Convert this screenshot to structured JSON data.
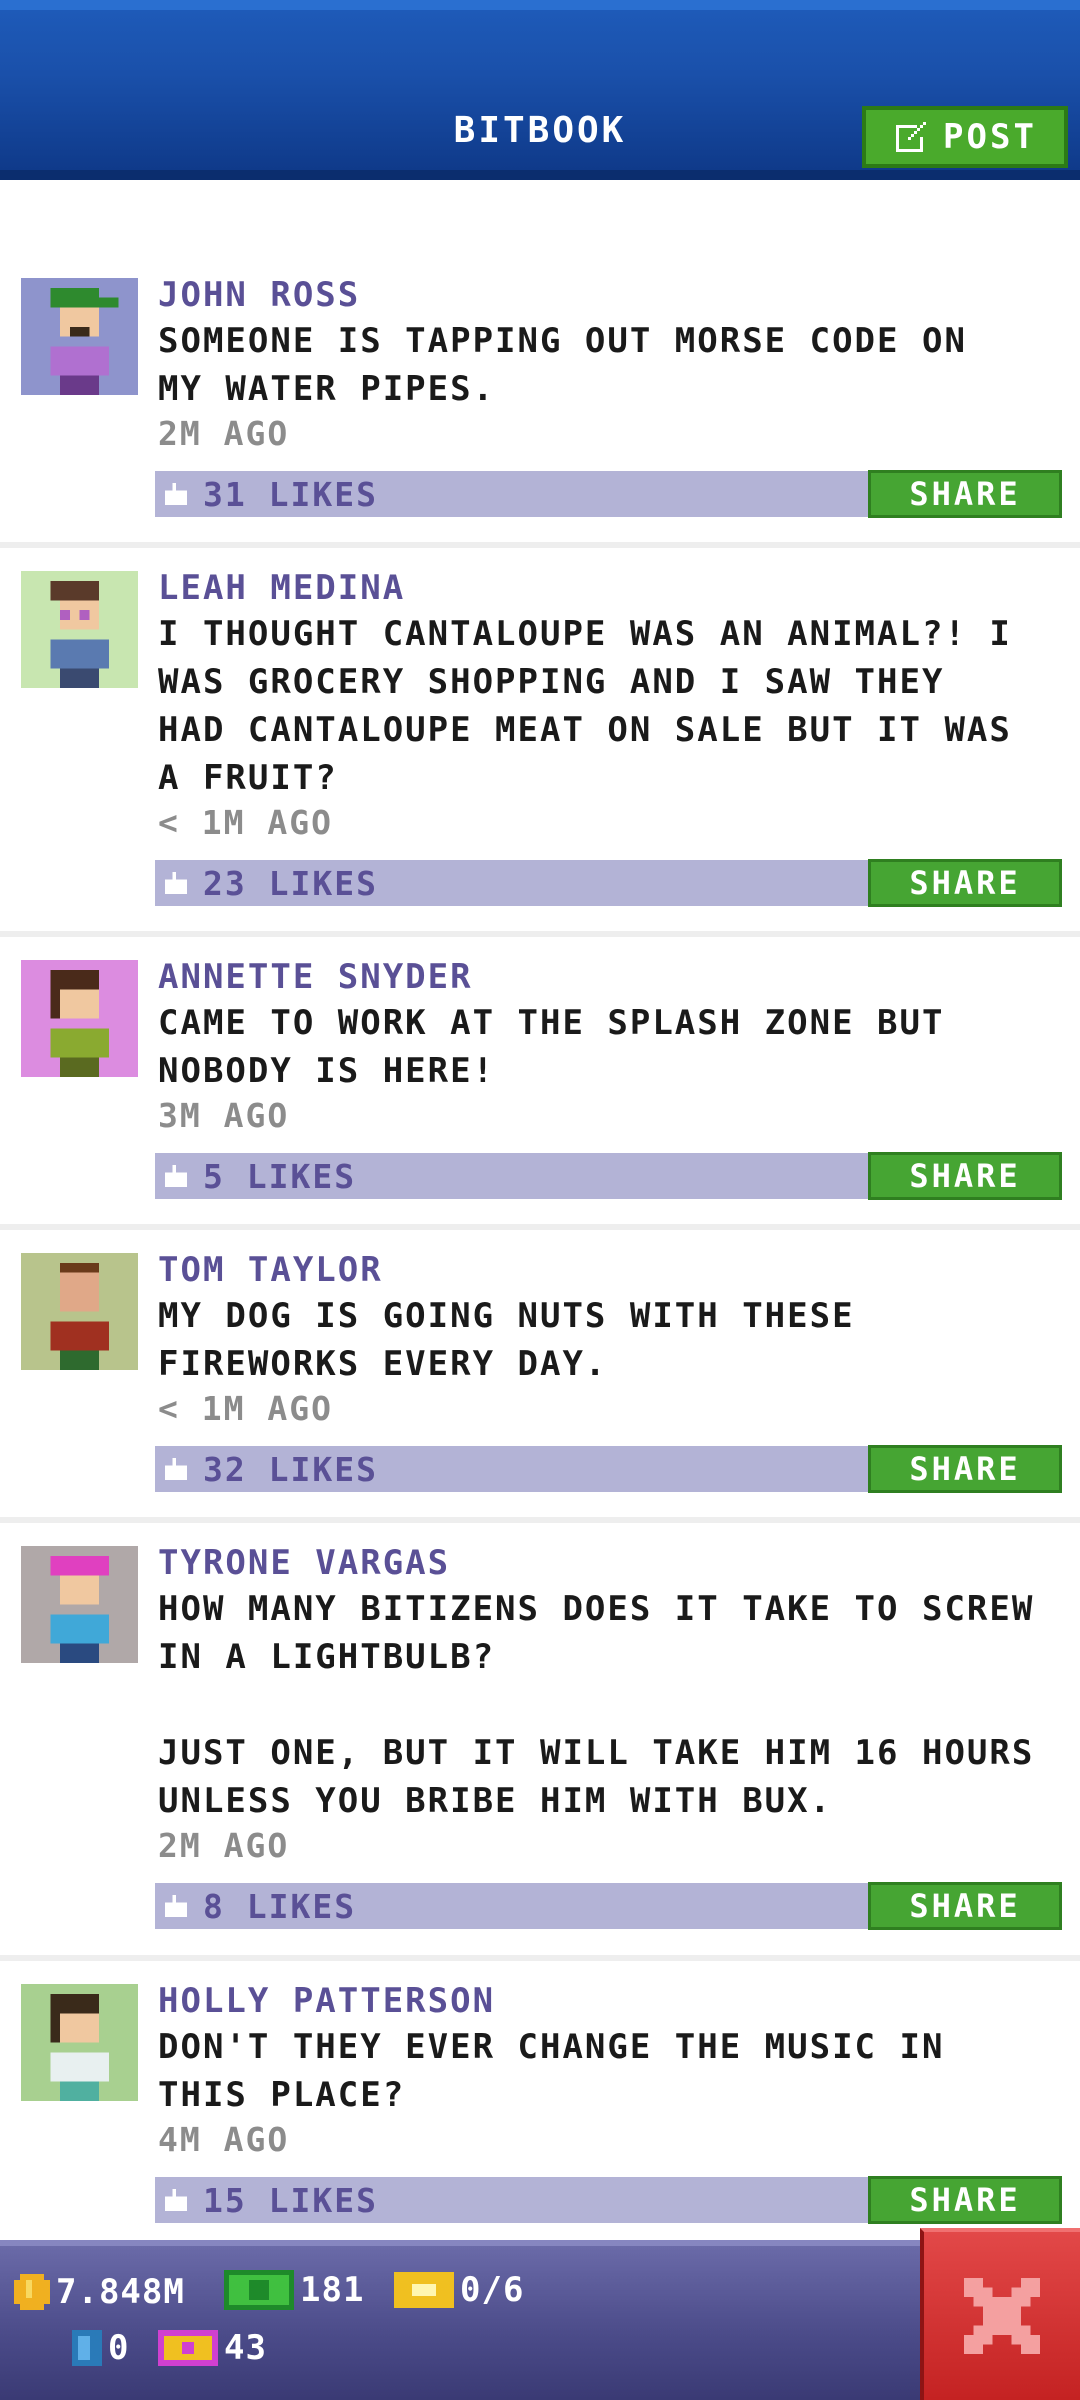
{
  "header": {
    "title": "BITBOOK",
    "post_label": "POST"
  },
  "posts": [
    {
      "name": "JOHN ROSS",
      "text": "SOMEONE IS TAPPING OUT MORSE CODE ON\nMY WATER PIPES.",
      "time": "2M AGO",
      "likes": "31 LIKES",
      "share": "SHARE",
      "avatar_bg": "#8e94cc"
    },
    {
      "name": "LEAH MEDINA",
      "text": "I THOUGHT CANTALOUPE WAS AN ANIMAL?! I\nWAS GROCERY SHOPPING AND I SAW THEY\nHAD CANTALOUPE MEAT ON SALE BUT IT WAS\nA FRUIT?",
      "time": "< 1M AGO",
      "likes": "23 LIKES",
      "share": "SHARE",
      "avatar_bg": "#c8e6b0"
    },
    {
      "name": "ANNETTE SNYDER",
      "text": "CAME TO WORK AT THE SPLASH ZONE BUT\nNOBODY IS HERE!",
      "time": "3M AGO",
      "likes": "5 LIKES",
      "share": "SHARE",
      "avatar_bg": "#dc8ce0"
    },
    {
      "name": "TOM TAYLOR",
      "text": "MY DOG IS GOING NUTS WITH THESE\nFIREWORKS EVERY DAY.",
      "time": "< 1M AGO",
      "likes": "32 LIKES",
      "share": "SHARE",
      "avatar_bg": "#b8c48c"
    },
    {
      "name": "TYRONE VARGAS",
      "text": "HOW MANY BITIZENS DOES IT TAKE TO SCREW\nIN A LIGHTBULB?\n\nJUST ONE, BUT IT WILL TAKE HIM 16 HOURS\nUNLESS YOU BRIBE HIM WITH BUX.",
      "time": "2M AGO",
      "likes": "8 LIKES",
      "share": "SHARE",
      "avatar_bg": "#b0a8a8"
    },
    {
      "name": "HOLLY PATTERSON",
      "text": "DON'T THEY EVER CHANGE THE MUSIC IN\nTHIS PLACE?",
      "time": "4M AGO",
      "likes": "15 LIKES",
      "share": "SHARE",
      "avatar_bg": "#a8d090"
    }
  ],
  "status": {
    "coins": "7.848M",
    "bux": "181",
    "tickets": "0/6",
    "keys": "0",
    "vip": "43"
  },
  "colors": {
    "header": "#1a50aa",
    "share": "#46a533",
    "likebar": "#b3b3d6",
    "name": "#5a5096",
    "close": "#d43232"
  }
}
